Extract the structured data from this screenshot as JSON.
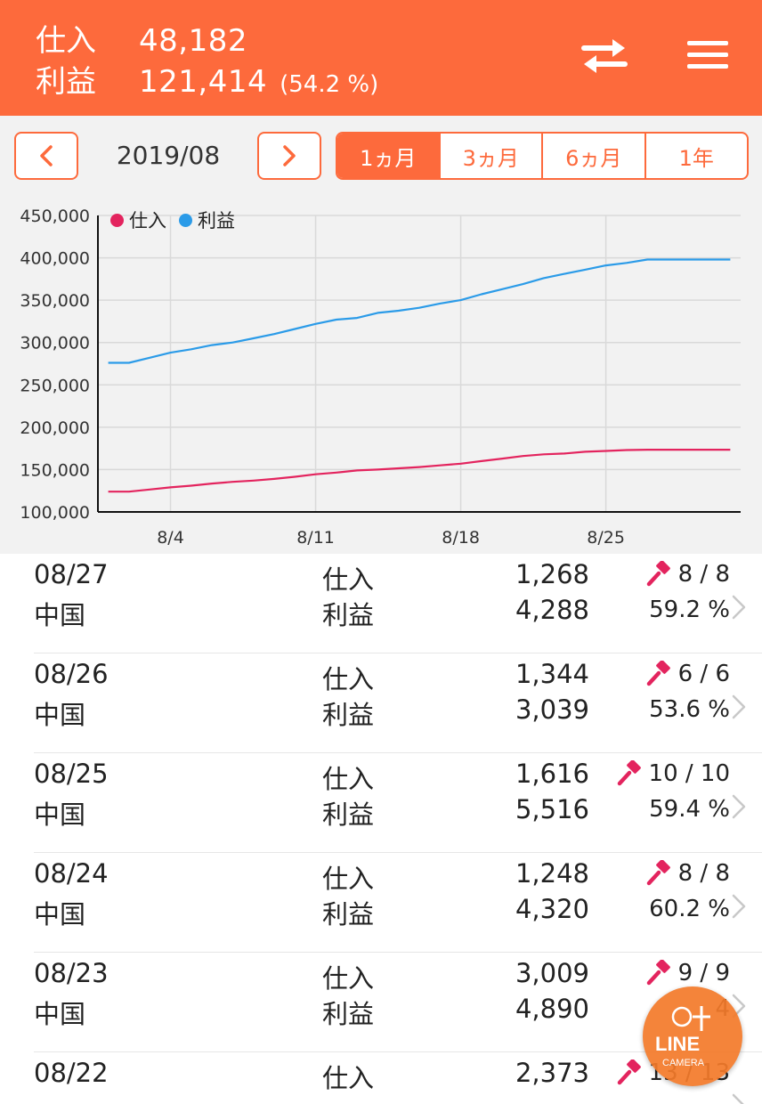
{
  "header": {
    "purchase_label": "仕入",
    "purchase_value": "48,182",
    "profit_label": "利益",
    "profit_value": "121,414",
    "profit_pct": "(54.2 %)",
    "swap_icon": "swap-icon",
    "menu_icon": "hamburger-menu-icon",
    "bg_color": "#fd6a3c"
  },
  "toolbar": {
    "prev_label": "<",
    "month": "2019/08",
    "next_label": ">",
    "ranges": [
      "1ヵ月",
      "3ヵ月",
      "6ヵ月",
      "1年"
    ],
    "active_range": "1ヵ月"
  },
  "chart_data": {
    "type": "line",
    "x_ticks": [
      "8/4",
      "8/11",
      "8/18",
      "8/25"
    ],
    "x_tick_days": [
      4,
      11,
      18,
      25
    ],
    "x_range": [
      0.5,
      31.5
    ],
    "ylim": [
      100000,
      450000
    ],
    "y_ticks": [
      "100,000",
      "150,000",
      "200,000",
      "250,000",
      "300,000",
      "350,000",
      "400,000",
      "450,000"
    ],
    "y_tick_values": [
      100000,
      150000,
      200000,
      250000,
      300000,
      350000,
      400000,
      450000
    ],
    "grid": true,
    "legend_position": "top-left",
    "series": [
      {
        "name": "仕入",
        "color": "#e3245e",
        "x": [
          1,
          2,
          3,
          4,
          5,
          6,
          7,
          8,
          9,
          10,
          11,
          12,
          13,
          14,
          15,
          16,
          17,
          18,
          19,
          20,
          21,
          22,
          23,
          24,
          25,
          26,
          27,
          28,
          29,
          30,
          31
        ],
        "values": [
          124000,
          124000,
          126500,
          129000,
          131000,
          133500,
          135500,
          137000,
          139000,
          141500,
          144500,
          146500,
          149000,
          150000,
          151500,
          153000,
          155000,
          157000,
          160000,
          163000,
          166000,
          168000,
          169000,
          171000,
          172000,
          173000,
          173500,
          173500,
          173500,
          173500,
          173500
        ]
      },
      {
        "name": "利益",
        "color": "#2b9be8",
        "x": [
          1,
          2,
          3,
          4,
          5,
          6,
          7,
          8,
          9,
          10,
          11,
          12,
          13,
          14,
          15,
          16,
          17,
          18,
          19,
          20,
          21,
          22,
          23,
          24,
          25,
          26,
          27,
          28,
          29,
          30,
          31
        ],
        "values": [
          276000,
          276000,
          282000,
          288000,
          292000,
          297000,
          300000,
          305000,
          310000,
          316000,
          322000,
          327000,
          329000,
          335000,
          337500,
          341000,
          346000,
          350000,
          357000,
          363000,
          369000,
          376000,
          381000,
          386000,
          391000,
          394000,
          398000,
          398000,
          398000,
          398000,
          398000
        ]
      }
    ]
  },
  "list": {
    "rows": [
      {
        "date": "08/27",
        "country": "中国",
        "label1": "仕入",
        "label2": "利益",
        "value1": "1,268",
        "value2": "4,288",
        "bids": "8 / 8",
        "rate": "59.2 %"
      },
      {
        "date": "08/26",
        "country": "中国",
        "label1": "仕入",
        "label2": "利益",
        "value1": "1,344",
        "value2": "3,039",
        "bids": "6 / 6",
        "rate": "53.6 %"
      },
      {
        "date": "08/25",
        "country": "中国",
        "label1": "仕入",
        "label2": "利益",
        "value1": "1,616",
        "value2": "5,516",
        "bids": "10 / 10",
        "rate": "59.4 %"
      },
      {
        "date": "08/24",
        "country": "中国",
        "label1": "仕入",
        "label2": "利益",
        "value1": "1,248",
        "value2": "4,320",
        "bids": "8 / 8",
        "rate": "60.2 %"
      },
      {
        "date": "08/23",
        "country": "中国",
        "label1": "仕入",
        "label2": "利益",
        "value1": "3,009",
        "value2": "4,890",
        "bids": "9 / 9",
        "rate": "4"
      },
      {
        "date": "08/22",
        "country": "",
        "label1": "仕入",
        "label2": "",
        "value1": "2,373",
        "value2": "",
        "bids": "13 / 13",
        "rate": ""
      }
    ],
    "row_icon": "gavel-icon",
    "chevron_icon": "chevron-right-icon"
  },
  "floating_button": {
    "label": "LINE",
    "sub_label": "CAMERA",
    "icon": "line-camera-icon"
  }
}
